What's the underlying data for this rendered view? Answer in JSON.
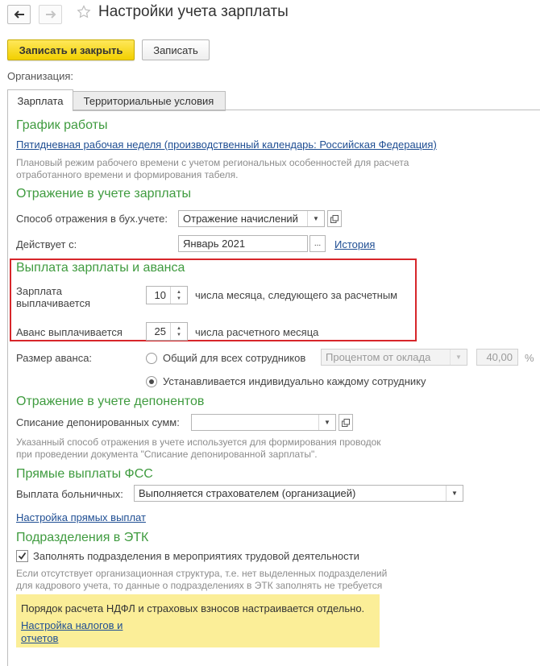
{
  "window": {
    "title": "Настройки учета зарплаты",
    "back_icon": "arrow-left-icon",
    "forward_icon": "arrow-right-icon",
    "favorite_icon": "star-icon"
  },
  "toolbar": {
    "save_close_label": "Записать и закрыть",
    "save_label": "Записать"
  },
  "organization": {
    "label": "Организация:"
  },
  "tabs": [
    {
      "label": "Зарплата",
      "active": true
    },
    {
      "label": "Территориальные условия",
      "active": false
    }
  ],
  "schedule": {
    "heading": "График работы",
    "link": "Пятидневная рабочая неделя (производственный календарь: Российская Федерация)",
    "note_line1": "Плановый режим рабочего времени с учетом региональных особенностей для расчета",
    "note_line2": "отработанного времени и формирования табеля."
  },
  "accounting": {
    "heading": "Отражение в учете зарплаты",
    "method_label": "Способ отражения в бух.учете:",
    "method_value": "Отражение начислений",
    "effective_label": "Действует с:",
    "effective_value": "Январь 2021",
    "history_link": "История"
  },
  "payment": {
    "heading": "Выплата зарплаты и аванса",
    "salary_label_line1": "Зарплата",
    "salary_label_line2": "выплачивается",
    "salary_day": "10",
    "salary_suffix": "числа месяца, следующего за расчетным",
    "advance_label": "Аванс выплачивается",
    "advance_day": "25",
    "advance_suffix": "числа расчетного месяца"
  },
  "advance_size": {
    "label": "Размер аванса:",
    "option_common": "Общий для всех сотрудников",
    "option_individual": "Устанавливается индивидуально каждому сотруднику",
    "selected": "individual",
    "method_value": "Процентом от оклада",
    "percent_value": "40,00",
    "percent_sign": "%"
  },
  "deposits": {
    "heading": "Отражение в учете депонентов",
    "writeoff_label": "Списание депонированных сумм:",
    "writeoff_value": "",
    "note_line1": "Указанный способ отражения в учете используется для формирования проводок",
    "note_line2": "при проведении документа \"Списание депонированной зарплаты\"."
  },
  "fss": {
    "heading": "Прямые выплаты ФСС",
    "sick_label": "Выплата больничных:",
    "sick_value": "Выполняется страхователем (организацией)",
    "settings_link": "Настройка прямых выплат"
  },
  "etk": {
    "heading": "Подразделения в ЭТК",
    "checkbox_label": "Заполнять подразделения в мероприятиях трудовой деятельности",
    "checked": true,
    "note_line1": "Если отсутствует организационная структура, т.е. нет выделенных подразделений",
    "note_line2": "для кадрового учета, то данные о подразделениях в ЭТК заполнять не требуется"
  },
  "info": {
    "text": "Порядок расчета НДФЛ и страховых взносов настраивается отдельно.",
    "link_line1": "Настройка налогов и",
    "link_line2": "отчетов"
  },
  "colors": {
    "accent_green": "#3f9b3f",
    "primary_button": "#f2d000",
    "link_blue": "#1f4e93",
    "highlight_red": "#d7262a",
    "info_yellow": "#fbee98"
  }
}
